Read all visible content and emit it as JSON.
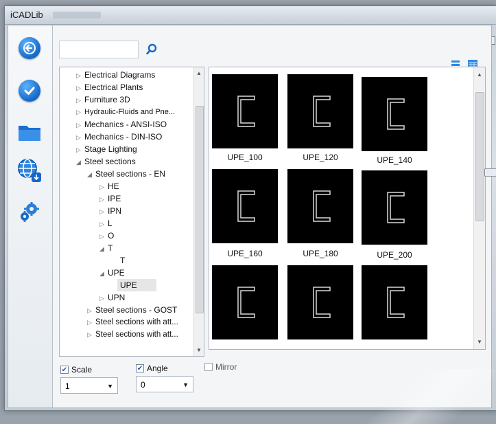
{
  "window": {
    "title": "iCADLib"
  },
  "rail": [
    {
      "name": "back-arrow-icon"
    },
    {
      "name": "check-icon"
    },
    {
      "name": "folder-icon"
    },
    {
      "name": "globe-download-icon"
    },
    {
      "name": "gears-icon"
    }
  ],
  "search": {
    "value": "",
    "placeholder": "",
    "icon": "search-icon"
  },
  "tree": {
    "items": [
      {
        "label": "Electrical Diagrams",
        "expanded": false
      },
      {
        "label": "Electrical Plants",
        "expanded": false
      },
      {
        "label": "Furniture 3D",
        "expanded": false
      },
      {
        "label": "Hydraulic-Fluids and Pne...",
        "expanded": false
      },
      {
        "label": "Mechanics - ANSI-ISO",
        "expanded": false
      },
      {
        "label": "Mechanics - DIN-ISO",
        "expanded": false
      },
      {
        "label": "Stage Lighting",
        "expanded": false
      },
      {
        "label": "Steel sections",
        "expanded": true
      },
      {
        "label": "Steel sections - EN",
        "expanded": true
      },
      {
        "label": "HE",
        "expanded": false
      },
      {
        "label": "IPE",
        "expanded": false
      },
      {
        "label": "IPN",
        "expanded": false
      },
      {
        "label": "L",
        "expanded": false
      },
      {
        "label": "O",
        "expanded": false
      },
      {
        "label": "T",
        "expanded": true
      },
      {
        "label": "T",
        "expanded": false
      },
      {
        "label": "UPE",
        "expanded": true
      },
      {
        "label": "UPE",
        "expanded": false,
        "selected": true
      },
      {
        "label": "UPN",
        "expanded": false
      },
      {
        "label": "Steel sections - GOST",
        "expanded": false
      },
      {
        "label": "Steel sections with att...",
        "expanded": false
      },
      {
        "label": "Steel sections with att...",
        "expanded": false
      }
    ]
  },
  "gallery": {
    "tiles": [
      {
        "label": "UPE_100"
      },
      {
        "label": "UPE_120"
      },
      {
        "label": "UPE_140"
      },
      {
        "label": "UPE_160"
      },
      {
        "label": "UPE_180"
      },
      {
        "label": "UPE_200"
      },
      {
        "label": ""
      },
      {
        "label": ""
      },
      {
        "label": ""
      }
    ]
  },
  "options": {
    "scale_label": "Scale",
    "scale_checked": true,
    "scale_value": "1",
    "angle_label": "Angle",
    "angle_checked": true,
    "angle_value": "0",
    "mirror_label": "Mirror",
    "mirror_checked": false
  },
  "colors": {
    "accent": "#1469c7",
    "tile_bg": "#000000",
    "tile_stroke": "#d9d9d9"
  }
}
